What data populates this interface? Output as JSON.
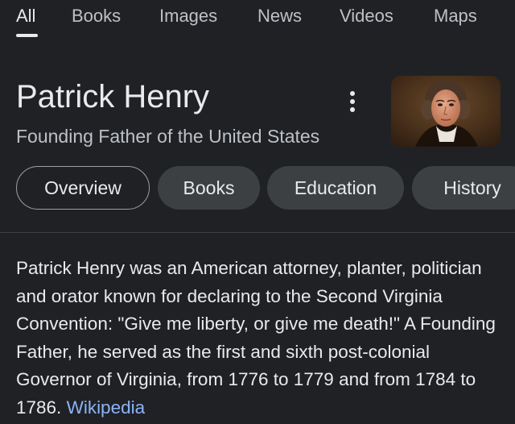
{
  "search_tabs": [
    {
      "label": "All",
      "active": true
    },
    {
      "label": "Books",
      "active": false
    },
    {
      "label": "Images",
      "active": false
    },
    {
      "label": "News",
      "active": false
    },
    {
      "label": "Videos",
      "active": false
    },
    {
      "label": "Maps",
      "active": false
    }
  ],
  "entity": {
    "title": "Patrick Henry",
    "subtitle": "Founding Father of the United States",
    "more_icon": "more-vertical-icon"
  },
  "chips": [
    {
      "label": "Overview",
      "selected": true
    },
    {
      "label": "Books",
      "selected": false
    },
    {
      "label": "Education",
      "selected": false
    },
    {
      "label": "History",
      "selected": false
    }
  ],
  "description": {
    "text": "Patrick Henry was an American attorney, planter, politician and orator known for declaring to the Second Virginia Convention: \"Give me liberty, or give me death!\" A Founding Father, he served as the first and sixth post-colonial Governor of Virginia, from 1776 to 1779 and from 1784 to 1786.",
    "source_label": "Wikipedia"
  },
  "colors": {
    "background": "#202124",
    "text_primary": "#e8eaed",
    "text_secondary": "#bdc1c6",
    "chip_background": "#3c4043",
    "link": "#8ab4f8"
  }
}
